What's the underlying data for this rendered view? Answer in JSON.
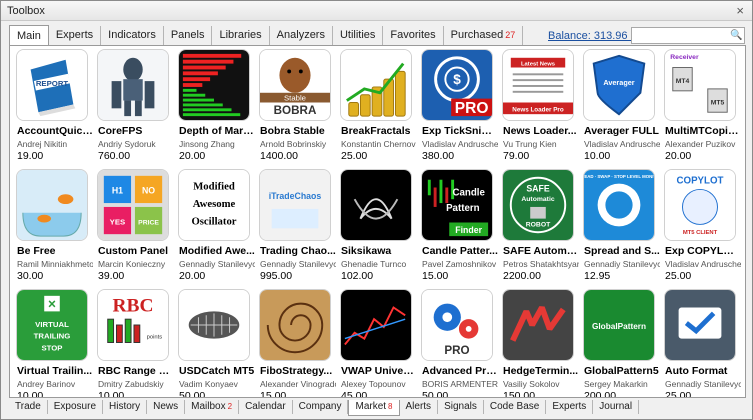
{
  "window": {
    "title": "Toolbox",
    "close": "×"
  },
  "tabs": [
    {
      "label": "Main",
      "active": true,
      "badge": ""
    },
    {
      "label": "Experts",
      "active": false,
      "badge": ""
    },
    {
      "label": "Indicators",
      "active": false,
      "badge": ""
    },
    {
      "label": "Panels",
      "active": false,
      "badge": ""
    },
    {
      "label": "Libraries",
      "active": false,
      "badge": ""
    },
    {
      "label": "Analyzers",
      "active": false,
      "badge": ""
    },
    {
      "label": "Utilities",
      "active": false,
      "badge": ""
    },
    {
      "label": "Favorites",
      "active": false,
      "badge": ""
    },
    {
      "label": "Purchased",
      "active": false,
      "badge": "27"
    }
  ],
  "balance": "Balance: 313.96 USD",
  "search": {
    "value": "",
    "placeholder": ""
  },
  "products": [
    {
      "name": "AccountQuick...",
      "author": "Andrej Nikitin",
      "price": "19.00",
      "art": "report"
    },
    {
      "name": "CoreFPS",
      "author": "Andriy Sydoruk",
      "price": "760.00",
      "art": "robot"
    },
    {
      "name": "Depth of Market",
      "author": "Jinsong Zhang",
      "price": "20.00",
      "art": "depth"
    },
    {
      "name": "Bobra Stable",
      "author": "Arnold Bobrinskiy",
      "price": "1400.00",
      "art": "bobra"
    },
    {
      "name": "BreakFractals",
      "author": "Konstantin Chernov",
      "price": "25.00",
      "art": "coins"
    },
    {
      "name": "Exp TickSnipe...",
      "author": "Vladislav Andrusche...",
      "price": "380.00",
      "art": "target"
    },
    {
      "name": "News Loader...",
      "author": "Vu Trung Kien",
      "price": "79.00",
      "art": "news"
    },
    {
      "name": "Averager FULL",
      "author": "Vladislav Andrusche...",
      "price": "10.00",
      "art": "shield"
    },
    {
      "name": "MultiMTCopie...",
      "author": "Alexander Puzikov",
      "price": "20.00",
      "art": "receiver"
    },
    {
      "name": "Be Free",
      "author": "Ramil Minniakhmetov",
      "price": "30.00",
      "art": "fish"
    },
    {
      "name": "Custom Panel",
      "author": "Marcin Konieczny",
      "price": "39.00",
      "art": "puzzle"
    },
    {
      "name": "Modified Awe...",
      "author": "Gennadiy Stanilevych",
      "price": "20.00",
      "art": "mao"
    },
    {
      "name": "Trading Chao...",
      "author": "Gennadiy Stanilevych",
      "price": "995.00",
      "art": "chaos"
    },
    {
      "name": "Siksikawa",
      "author": "Ghenadie Turnco",
      "price": "102.00",
      "art": "knot"
    },
    {
      "name": "Candle Patter...",
      "author": "Pavel Zamoshnikov",
      "price": "15.00",
      "art": "candle"
    },
    {
      "name": "SAFE Automat...",
      "author": "Petros Shatakhtsyan",
      "price": "2200.00",
      "art": "safe"
    },
    {
      "name": "Spread and S...",
      "author": "Gennadiy Stanilevych",
      "price": "12.95",
      "art": "spread"
    },
    {
      "name": "Exp COPYLOT...",
      "author": "Vladislav Andrusche...",
      "price": "25.00",
      "art": "copylot"
    },
    {
      "name": "Virtual Trailin...",
      "author": "Andrey Barinov",
      "price": "10.00",
      "art": "virtual"
    },
    {
      "name": "RBC Range Ba...",
      "author": "Dmitry Zabudskiy",
      "price": "10.00",
      "art": "rbc"
    },
    {
      "name": "USDCatch MT5",
      "author": "Vadim Konyaev",
      "price": "50.00",
      "art": "fossil"
    },
    {
      "name": "FiboStrategy...",
      "author": "Alexander Vinogradov",
      "price": "15.00",
      "art": "shell"
    },
    {
      "name": "VWAP Universal",
      "author": "Alexey Topounov",
      "price": "45.00",
      "art": "vwap"
    },
    {
      "name": "Advanced Pric...",
      "author": "BORIS ARMENTEROS",
      "price": "50.00",
      "art": "gears"
    },
    {
      "name": "HedgeTermin...",
      "author": "Vasiliy Sokolov",
      "price": "150.00",
      "art": "hedge"
    },
    {
      "name": "GlobalPattern5",
      "author": "Sergey Makarkin",
      "price": "200.00",
      "art": "global"
    },
    {
      "name": "Auto Format",
      "author": "Gennadiy Stanilevych",
      "price": "25.00",
      "art": "autoformat"
    }
  ],
  "art_text": {
    "report": "REPORT",
    "bobra_top": "Stable",
    "bobra_bottom": "BOBRA",
    "target": "PRO",
    "news_top": "Latest News",
    "news_bottom": "News Loader Pro",
    "shield": "Averager",
    "receiver": "Receiver",
    "receiver_mt4": "MT4",
    "receiver_mt5": "MT5",
    "puzzle": [
      "H1",
      "NO",
      "YES",
      "PRICE"
    ],
    "mao": [
      "Modified",
      "Awesome",
      "Oscillator"
    ],
    "chaos": "iTradeChaos",
    "candle": [
      "Candle",
      "Pattern",
      "Finder"
    ],
    "safe": [
      "SAFE",
      "Automatic",
      "ROBOT"
    ],
    "spread": "SPREAD · SWAP · STOP LEVEL MONITOR",
    "copylot": "COPYLOT",
    "copylot_sub": "MT5 CLIENT",
    "virtual": [
      "VIRTUAL",
      "TRAILING",
      "STOP"
    ],
    "rbc": "RBC",
    "rbc_sub": "points",
    "gears": "PRO",
    "global": "GlobalPattern"
  },
  "bottom_tabs": [
    {
      "label": "Trade",
      "active": false,
      "badge": ""
    },
    {
      "label": "Exposure",
      "active": false,
      "badge": ""
    },
    {
      "label": "History",
      "active": false,
      "badge": ""
    },
    {
      "label": "News",
      "active": false,
      "badge": ""
    },
    {
      "label": "Mailbox",
      "active": false,
      "badge": "2"
    },
    {
      "label": "Calendar",
      "active": false,
      "badge": ""
    },
    {
      "label": "Company",
      "active": false,
      "badge": ""
    },
    {
      "label": "Market",
      "active": true,
      "badge": "8"
    },
    {
      "label": "Alerts",
      "active": false,
      "badge": ""
    },
    {
      "label": "Signals",
      "active": false,
      "badge": ""
    },
    {
      "label": "Code Base",
      "active": false,
      "badge": ""
    },
    {
      "label": "Experts",
      "active": false,
      "badge": ""
    },
    {
      "label": "Journal",
      "active": false,
      "badge": ""
    }
  ],
  "colors": {
    "link": "#1a4fa0",
    "badge": "#dd2222",
    "border": "#9a9a9a"
  }
}
